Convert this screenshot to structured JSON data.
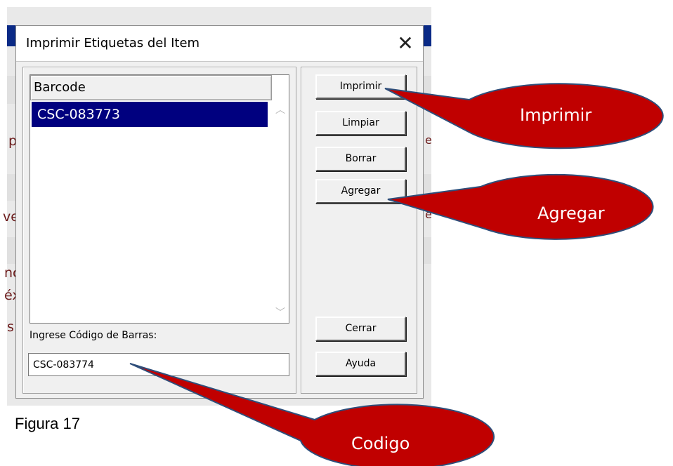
{
  "dialog": {
    "title": "Imprimir Etiquetas del Item",
    "close_glyph": "✕"
  },
  "list": {
    "header": "Barcode",
    "items": [
      "CSC-083773"
    ]
  },
  "input": {
    "label": "Ingrese Código de Barras:",
    "value": "CSC-083774"
  },
  "buttons": {
    "imprimir": "Imprimir",
    "limpiar": "Limpiar",
    "borrar": "Borrar",
    "agregar": "Agregar",
    "cerrar": "Cerrar",
    "ayuda": "Ayuda"
  },
  "callouts": {
    "imprimir": "Imprimir",
    "agregar": "Agregar",
    "codigo": "Codigo"
  },
  "caption": "Figura 17",
  "background_fragments": [
    "p",
    "ve",
    "nc",
    "éx",
    "s",
    "e",
    "e"
  ],
  "colors": {
    "callout_fill": "#c00000",
    "callout_stroke": "#2e4e7a",
    "selection": "#00007f"
  }
}
